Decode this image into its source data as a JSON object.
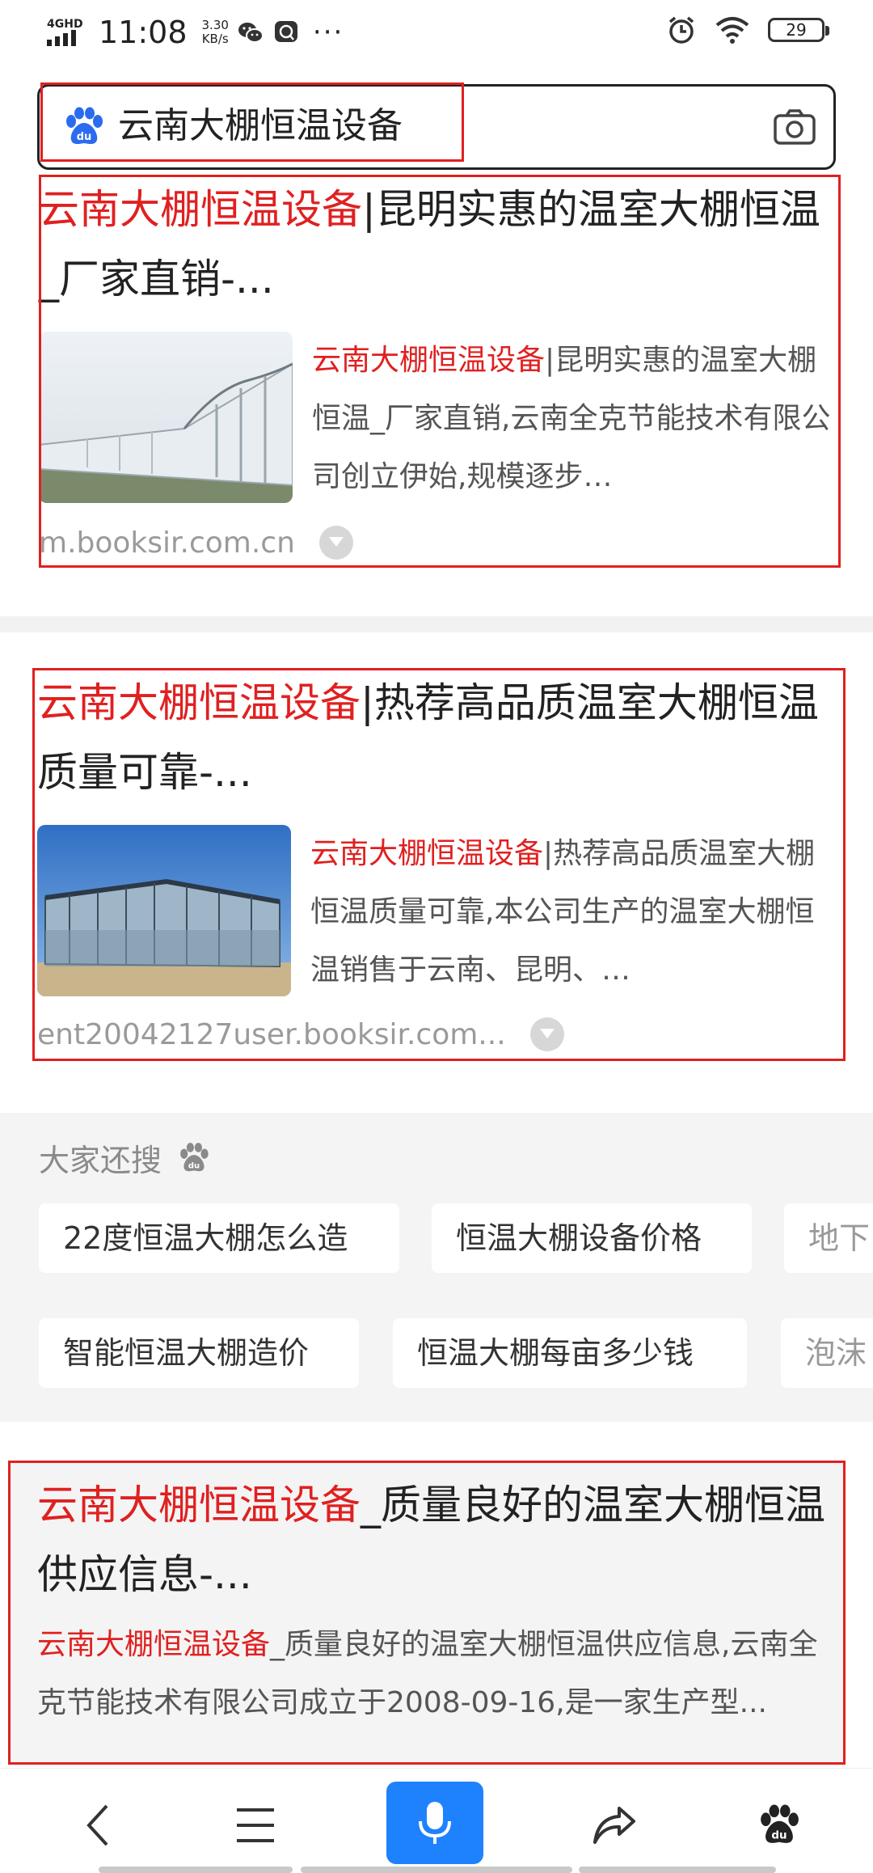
{
  "status_bar": {
    "network": "4GHD",
    "time": "11:08",
    "speed_value": "3.30",
    "speed_unit": "KB/s",
    "more": "···",
    "battery": "29"
  },
  "search": {
    "query": "云南大棚恒温设备"
  },
  "results": [
    {
      "title_kw": "云南大棚恒温设备",
      "title_rest": "|昆明实惠的温室大棚恒温_厂家直销-...",
      "snippet_kw": "云南大棚恒温设备",
      "snippet_rest": "|昆明实惠的温室大棚恒温_厂家直销,云南全克节能技术有限公司创立伊始,规模逐步…",
      "url": "m.booksir.com.cn"
    },
    {
      "title_kw": "云南大棚恒温设备",
      "title_rest": "|热荐高品质温室大棚恒温质量可靠-...",
      "snippet_kw": "云南大棚恒温设备",
      "snippet_rest": "|热荐高品质温室大棚恒温质量可靠,本公司生产的温室大棚恒温销售于云南、昆明、…",
      "url": "ent20042127user.booksir.com..."
    },
    {
      "title_kw": "云南大棚恒温设备",
      "title_rest": "_质量良好的温室大棚恒温供应信息-...",
      "snippet_kw": "云南大棚恒温设备",
      "snippet_rest": "_质量良好的温室大棚恒温供应信息,云南全克节能技术有限公司成立于2008-09-16,是一家生产型..."
    }
  ],
  "related": {
    "title": "大家还搜",
    "row1": [
      "22度恒温大棚怎么造",
      "恒温大棚设备价格",
      "地下"
    ],
    "row2": [
      "智能恒温大棚造价",
      "恒温大棚每亩多少钱",
      "泡沫"
    ]
  },
  "colors": {
    "keyword_red": "#e02020",
    "accent_blue": "#1e82ff"
  }
}
